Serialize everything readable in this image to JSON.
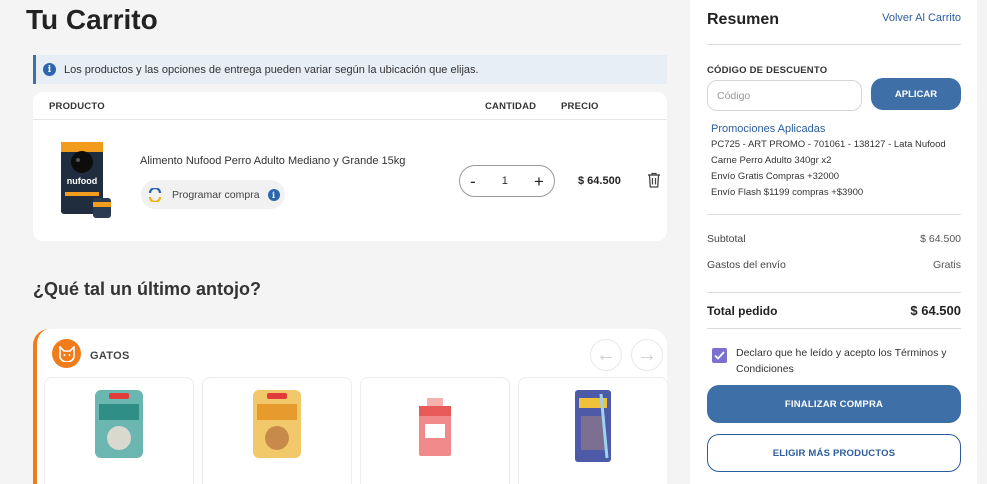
{
  "page": {
    "title": "Tu Carrito"
  },
  "info_banner": {
    "icon": "info-icon",
    "text": "Los productos y las opciones de entrega pueden variar según la ubicación que elijas."
  },
  "cart": {
    "headers": {
      "product": "PRODUCTO",
      "quantity": "CANTIDAD",
      "price": "PRECIO"
    },
    "items": [
      {
        "name": "Alimento Nufood Perro Adulto Mediano y Grande 15kg",
        "image_label": "nufood",
        "schedule_label": "Programar compra",
        "quantity": "1",
        "minus": "-",
        "plus": "+",
        "price": "$ 64.500"
      }
    ]
  },
  "upsell": {
    "title": "¿Qué tal un último antojo?",
    "category": "GATOS",
    "arrows": {
      "left": "←",
      "right": "→"
    }
  },
  "summary": {
    "title": "Resumen",
    "back_link": "Volver Al Carrito",
    "discount": {
      "label": "CÓDIGO DE DESCUENTO",
      "placeholder": "Código",
      "apply": "APLICAR"
    },
    "promotions": {
      "title": "Promociones Aplicadas",
      "lines": [
        "PC725 - ART PROMO - 701061 - 138127 - Lata Nufood",
        "Carne Perro Adulto 340gr x2",
        "Envío Gratis Compras +32000",
        "Envío Flash $1199 compras +$3900"
      ]
    },
    "subtotal": {
      "label": "Subtotal",
      "value": "$ 64.500"
    },
    "shipping": {
      "label": "Gastos del envío",
      "value": "Gratis"
    },
    "total": {
      "label": "Total pedido",
      "value": "$ 64.500"
    },
    "terms": {
      "checked": true,
      "text": "Declaro que he leído y acepto los Términos y Condiciones"
    },
    "finalize": "FINALIZAR COMPRA",
    "more": "ELIGIR MÁS PRODUCTOS"
  },
  "colors": {
    "primary": "#3e6fa6",
    "link": "#2c5c9c",
    "accent": "#f07c1c",
    "checkbox": "#7b6fd0"
  }
}
